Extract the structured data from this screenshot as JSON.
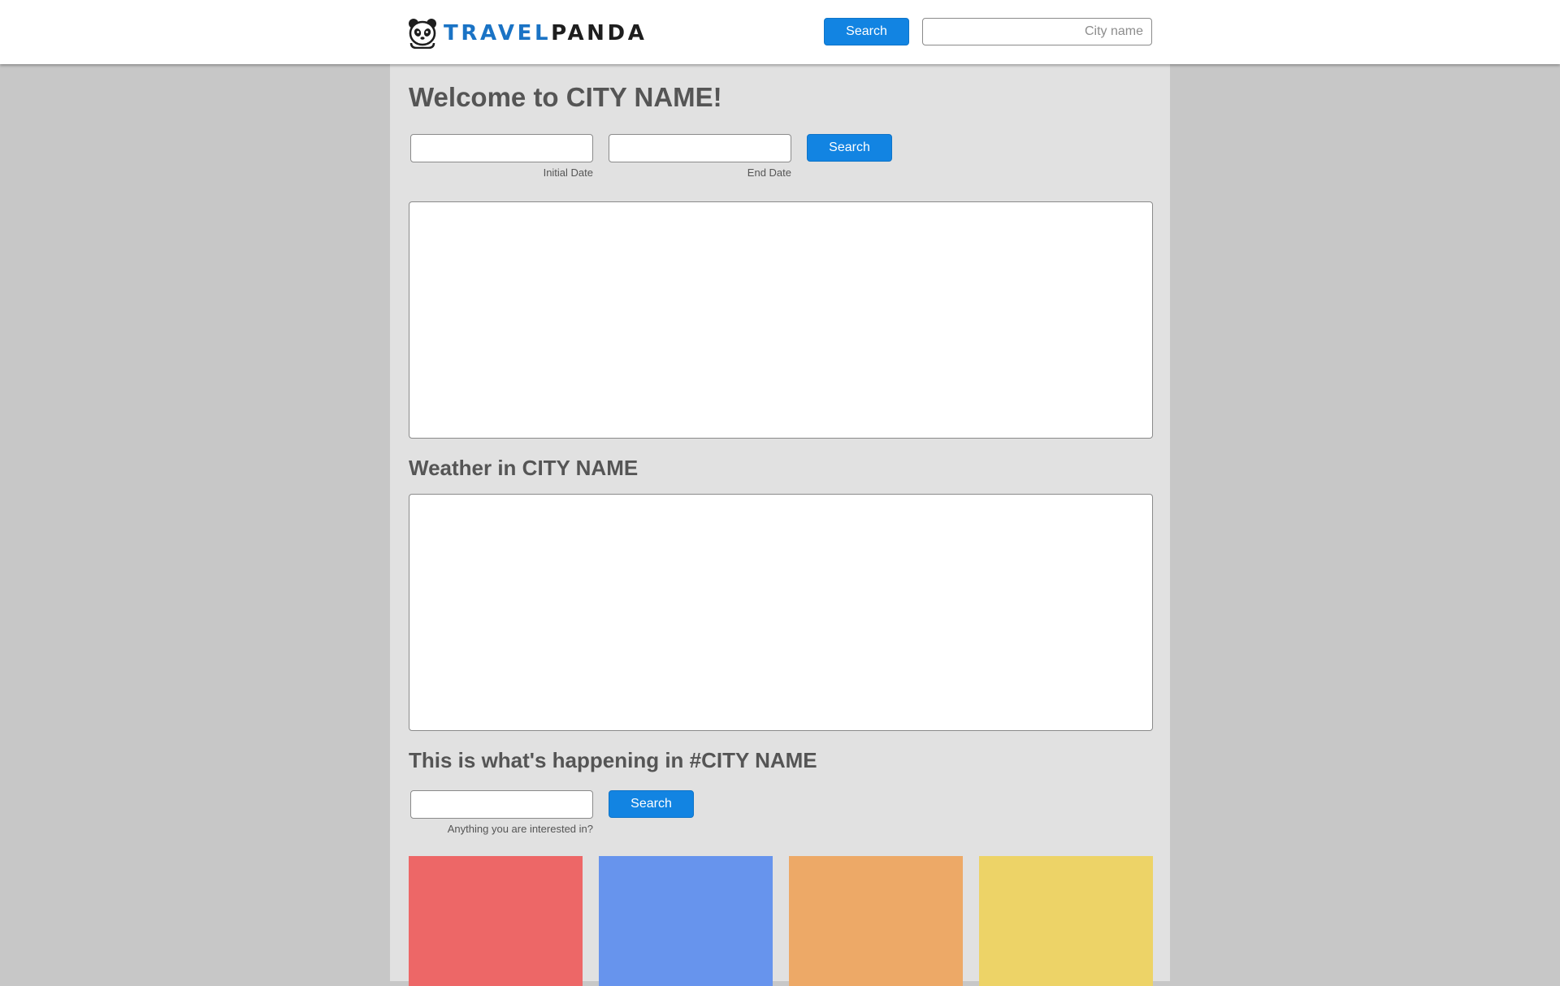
{
  "header": {
    "logo": {
      "icon": "panda-icon",
      "text_part1": "TRAVEL",
      "text_part2": "PANDA",
      "colors": {
        "travel": "#1a73c5",
        "panda": "#1e1e1e"
      }
    },
    "search_button_label": "Search",
    "city_input": {
      "value": "",
      "placeholder": "City name"
    }
  },
  "main": {
    "welcome_title": "Welcome to CITY NAME!",
    "date_search": {
      "initial_date": {
        "value": "",
        "label": "Initial Date"
      },
      "end_date": {
        "value": "",
        "label": "End Date"
      },
      "search_button_label": "Search"
    },
    "weather_title": "Weather in CITY NAME",
    "happening": {
      "title": "This is what's happening in #CITY NAME",
      "interest_input": {
        "value": "",
        "label": "Anything you are interested in?"
      },
      "search_button_label": "Search"
    },
    "tiles": [
      {
        "color": "#ed6767"
      },
      {
        "color": "#6794ed"
      },
      {
        "color": "#eda967"
      },
      {
        "color": "#edd367"
      }
    ]
  },
  "theme": {
    "accent": "#1284e2",
    "page_background": "#c7c7c7",
    "content_background": "#e1e1e1",
    "header_background": "#ffffff"
  }
}
